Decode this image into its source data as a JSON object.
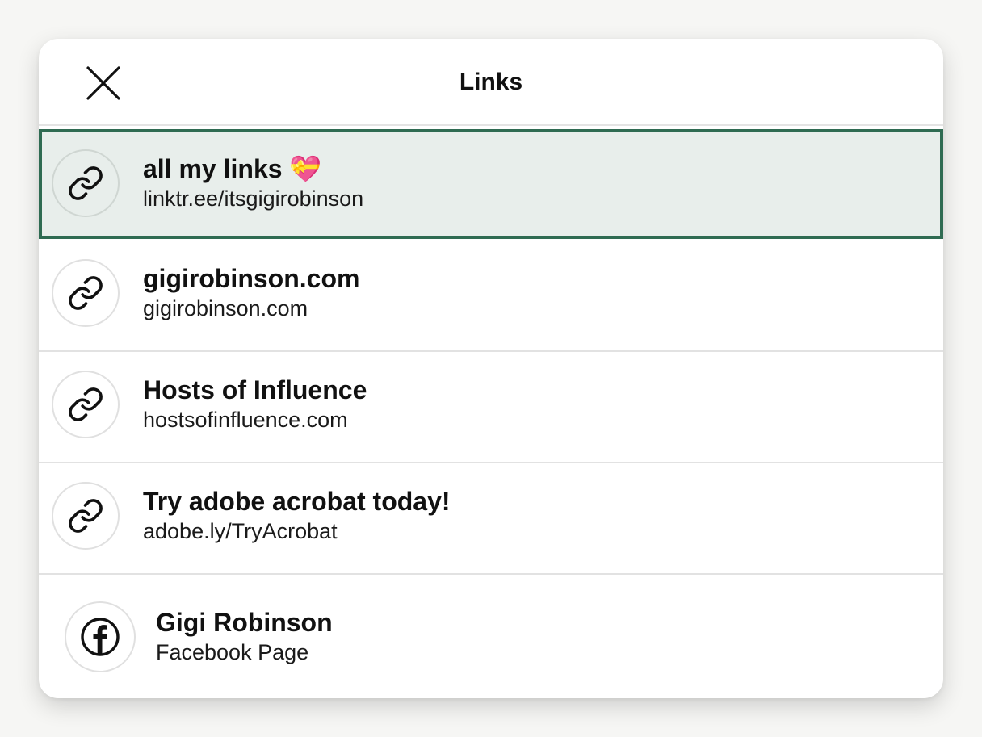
{
  "modal": {
    "title": "Links"
  },
  "links": [
    {
      "label": "all my links",
      "emoji": "💝",
      "url": "linktr.ee/itsgigirobinson",
      "icon": "link-icon"
    },
    {
      "label": "gigirobinson.com",
      "url": "gigirobinson.com",
      "icon": "link-icon"
    },
    {
      "label": "Hosts of Influence",
      "url": "hostsofinfluence.com",
      "icon": "link-icon"
    },
    {
      "label": "Try adobe acrobat today!",
      "url": "adobe.ly/TryAcrobat",
      "icon": "link-icon"
    },
    {
      "label": "Gigi Robinson",
      "url": "Facebook Page",
      "icon": "facebook-icon"
    }
  ],
  "colors": {
    "selected_background": "#e8eeeb",
    "selected_border": "#2f6b52",
    "text": "#111111"
  }
}
